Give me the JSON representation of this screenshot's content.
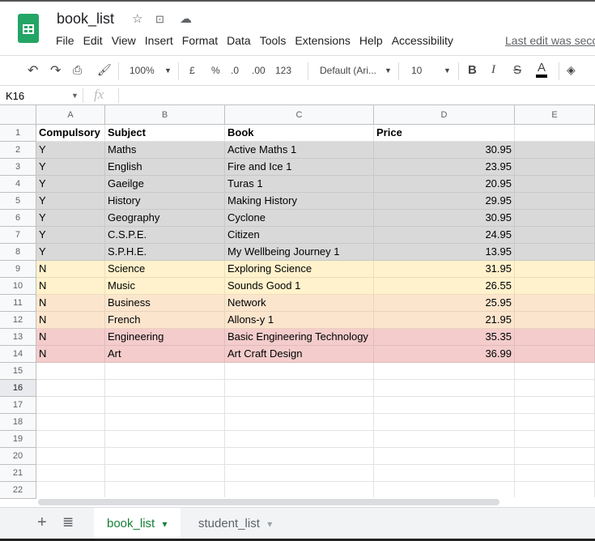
{
  "app": {
    "title": "book_list",
    "last_edit": "Last edit was seco"
  },
  "menu": [
    "File",
    "Edit",
    "View",
    "Insert",
    "Format",
    "Data",
    "Tools",
    "Extensions",
    "Help",
    "Accessibility"
  ],
  "toolbar": {
    "zoom": "100%",
    "currency": "£",
    "percent": "%",
    "dec_less": ".0",
    "dec_more": ".00",
    "format": "123",
    "font": "Default (Ari...",
    "font_size": "10",
    "bold": "B",
    "italic": "I",
    "strike": "S",
    "text_color": "A"
  },
  "formula_bar": {
    "cell_ref": "K16",
    "fx": "fx",
    "value": ""
  },
  "columns": [
    "A",
    "B",
    "C",
    "D",
    "E"
  ],
  "rows": [
    [
      "Compulsory",
      "Subject",
      "Book",
      "Price"
    ],
    [
      "Y",
      "Maths",
      "Active Maths 1",
      "30.95"
    ],
    [
      "Y",
      "English",
      "Fire and Ice 1",
      "23.95"
    ],
    [
      "Y",
      "Gaeilge",
      "Turas 1",
      "20.95"
    ],
    [
      "Y",
      "History",
      "Making History",
      "29.95"
    ],
    [
      "Y",
      "Geography",
      "Cyclone",
      "30.95"
    ],
    [
      "Y",
      "C.S.P.E.",
      "Citizen",
      "24.95"
    ],
    [
      "Y",
      "S.P.H.E.",
      "My Wellbeing Journey 1",
      "13.95"
    ],
    [
      "N",
      "Science",
      "Exploring Science",
      "31.95"
    ],
    [
      "N",
      "Music",
      "Sounds Good 1",
      "26.55"
    ],
    [
      "N",
      "Business",
      "Network",
      "25.95"
    ],
    [
      "N",
      "French",
      "Allons-y 1",
      "21.95"
    ],
    [
      "N",
      "Engineering",
      "Basic Engineering Technology",
      "35.35"
    ],
    [
      "N",
      "Art",
      "Art Craft Design",
      "36.99"
    ]
  ],
  "row_count": 22,
  "selected_row": 16,
  "row_colors": {
    "compulsory": "#d9d9d9",
    "yellow": "#fff2cc",
    "orange": "#fce5cd",
    "red": "#f4cccc"
  },
  "sheets": [
    {
      "name": "book_list",
      "active": true
    },
    {
      "name": "student_list",
      "active": false
    }
  ]
}
